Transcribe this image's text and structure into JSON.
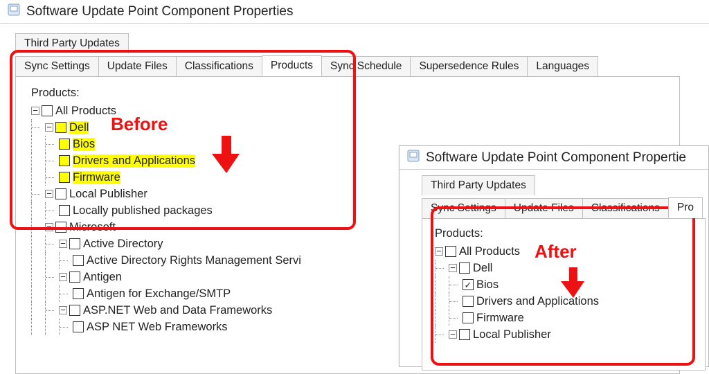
{
  "dialog_title": "Software Update Point Component Properties",
  "tabs_row_top": [
    "Third Party Updates"
  ],
  "tabs_row_bot": [
    "Sync Settings",
    "Update Files",
    "Classifications",
    "Products",
    "Sync Schedule",
    "Supersedence Rules",
    "Languages"
  ],
  "active_tab": "Products",
  "products_label": "Products:",
  "anno_before": "Before",
  "anno_after": "After",
  "tree_before": {
    "root": "All Products",
    "items": {
      "dell": "Dell",
      "bios": "Bios",
      "drv": "Drivers and Applications",
      "fw": "Firmware",
      "lp": "Local Publisher",
      "lpp": "Locally published packages",
      "ms": "Microsoft",
      "ad": "Active Directory",
      "adrms": "Active Directory Rights Management Servi",
      "antigen": "Antigen",
      "antigen_ex": "Antigen for Exchange/SMTP",
      "asp": "ASP.NET Web and Data Frameworks",
      "asp2": "ASP NET Web Frameworks"
    }
  },
  "tabs_after_row_top": [
    "Third Party Updates"
  ],
  "tabs_after_row_bot": [
    "Sync Settings",
    "Update Files",
    "Classifications",
    "Pro"
  ],
  "tree_after": {
    "root": "All Products",
    "dell": "Dell",
    "bios": "Bios",
    "drv": "Drivers and Applications",
    "fw": "Firmware",
    "lp": "Local Publisher"
  },
  "after_title": "Software Update Point Component Propertie"
}
